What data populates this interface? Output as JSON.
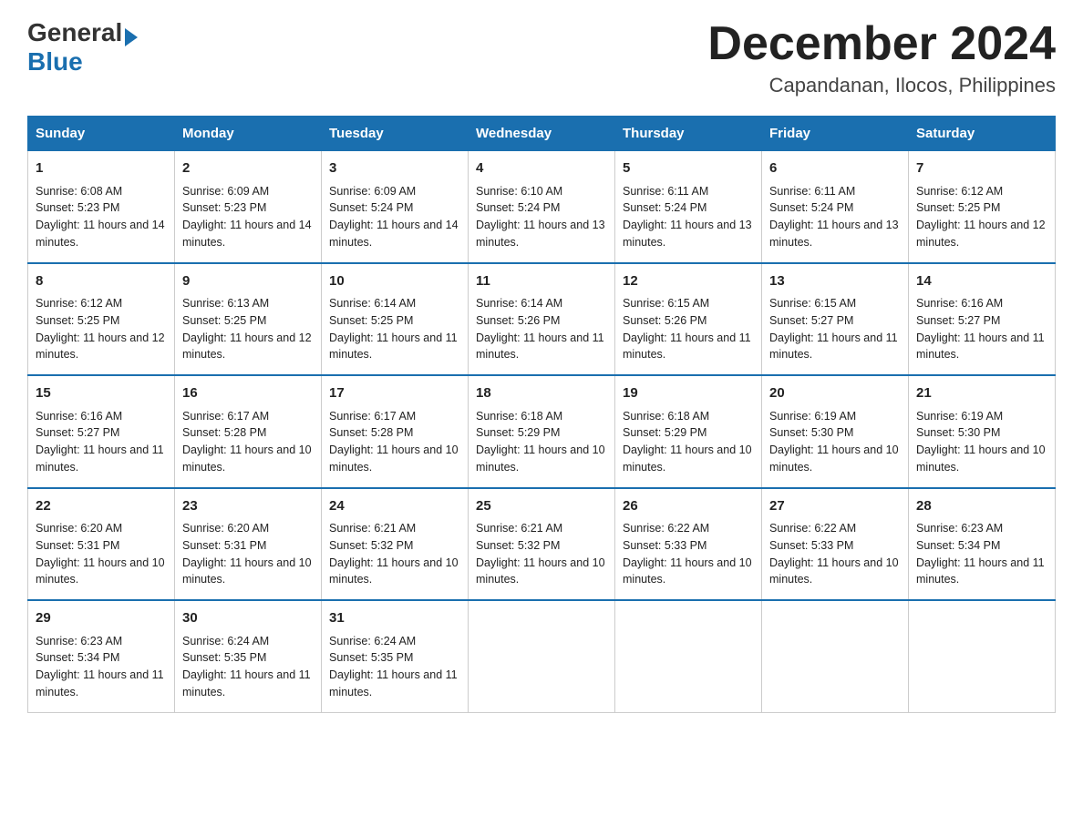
{
  "logo": {
    "general": "General",
    "blue": "Blue"
  },
  "header": {
    "month": "December 2024",
    "location": "Capandanan, Ilocos, Philippines"
  },
  "days": [
    "Sunday",
    "Monday",
    "Tuesday",
    "Wednesday",
    "Thursday",
    "Friday",
    "Saturday"
  ],
  "weeks": [
    [
      {
        "day": "1",
        "sunrise": "6:08 AM",
        "sunset": "5:23 PM",
        "daylight": "11 hours and 14 minutes."
      },
      {
        "day": "2",
        "sunrise": "6:09 AM",
        "sunset": "5:23 PM",
        "daylight": "11 hours and 14 minutes."
      },
      {
        "day": "3",
        "sunrise": "6:09 AM",
        "sunset": "5:24 PM",
        "daylight": "11 hours and 14 minutes."
      },
      {
        "day": "4",
        "sunrise": "6:10 AM",
        "sunset": "5:24 PM",
        "daylight": "11 hours and 13 minutes."
      },
      {
        "day": "5",
        "sunrise": "6:11 AM",
        "sunset": "5:24 PM",
        "daylight": "11 hours and 13 minutes."
      },
      {
        "day": "6",
        "sunrise": "6:11 AM",
        "sunset": "5:24 PM",
        "daylight": "11 hours and 13 minutes."
      },
      {
        "day": "7",
        "sunrise": "6:12 AM",
        "sunset": "5:25 PM",
        "daylight": "11 hours and 12 minutes."
      }
    ],
    [
      {
        "day": "8",
        "sunrise": "6:12 AM",
        "sunset": "5:25 PM",
        "daylight": "11 hours and 12 minutes."
      },
      {
        "day": "9",
        "sunrise": "6:13 AM",
        "sunset": "5:25 PM",
        "daylight": "11 hours and 12 minutes."
      },
      {
        "day": "10",
        "sunrise": "6:14 AM",
        "sunset": "5:25 PM",
        "daylight": "11 hours and 11 minutes."
      },
      {
        "day": "11",
        "sunrise": "6:14 AM",
        "sunset": "5:26 PM",
        "daylight": "11 hours and 11 minutes."
      },
      {
        "day": "12",
        "sunrise": "6:15 AM",
        "sunset": "5:26 PM",
        "daylight": "11 hours and 11 minutes."
      },
      {
        "day": "13",
        "sunrise": "6:15 AM",
        "sunset": "5:27 PM",
        "daylight": "11 hours and 11 minutes."
      },
      {
        "day": "14",
        "sunrise": "6:16 AM",
        "sunset": "5:27 PM",
        "daylight": "11 hours and 11 minutes."
      }
    ],
    [
      {
        "day": "15",
        "sunrise": "6:16 AM",
        "sunset": "5:27 PM",
        "daylight": "11 hours and 11 minutes."
      },
      {
        "day": "16",
        "sunrise": "6:17 AM",
        "sunset": "5:28 PM",
        "daylight": "11 hours and 10 minutes."
      },
      {
        "day": "17",
        "sunrise": "6:17 AM",
        "sunset": "5:28 PM",
        "daylight": "11 hours and 10 minutes."
      },
      {
        "day": "18",
        "sunrise": "6:18 AM",
        "sunset": "5:29 PM",
        "daylight": "11 hours and 10 minutes."
      },
      {
        "day": "19",
        "sunrise": "6:18 AM",
        "sunset": "5:29 PM",
        "daylight": "11 hours and 10 minutes."
      },
      {
        "day": "20",
        "sunrise": "6:19 AM",
        "sunset": "5:30 PM",
        "daylight": "11 hours and 10 minutes."
      },
      {
        "day": "21",
        "sunrise": "6:19 AM",
        "sunset": "5:30 PM",
        "daylight": "11 hours and 10 minutes."
      }
    ],
    [
      {
        "day": "22",
        "sunrise": "6:20 AM",
        "sunset": "5:31 PM",
        "daylight": "11 hours and 10 minutes."
      },
      {
        "day": "23",
        "sunrise": "6:20 AM",
        "sunset": "5:31 PM",
        "daylight": "11 hours and 10 minutes."
      },
      {
        "day": "24",
        "sunrise": "6:21 AM",
        "sunset": "5:32 PM",
        "daylight": "11 hours and 10 minutes."
      },
      {
        "day": "25",
        "sunrise": "6:21 AM",
        "sunset": "5:32 PM",
        "daylight": "11 hours and 10 minutes."
      },
      {
        "day": "26",
        "sunrise": "6:22 AM",
        "sunset": "5:33 PM",
        "daylight": "11 hours and 10 minutes."
      },
      {
        "day": "27",
        "sunrise": "6:22 AM",
        "sunset": "5:33 PM",
        "daylight": "11 hours and 10 minutes."
      },
      {
        "day": "28",
        "sunrise": "6:23 AM",
        "sunset": "5:34 PM",
        "daylight": "11 hours and 11 minutes."
      }
    ],
    [
      {
        "day": "29",
        "sunrise": "6:23 AM",
        "sunset": "5:34 PM",
        "daylight": "11 hours and 11 minutes."
      },
      {
        "day": "30",
        "sunrise": "6:24 AM",
        "sunset": "5:35 PM",
        "daylight": "11 hours and 11 minutes."
      },
      {
        "day": "31",
        "sunrise": "6:24 AM",
        "sunset": "5:35 PM",
        "daylight": "11 hours and 11 minutes."
      },
      null,
      null,
      null,
      null
    ]
  ],
  "labels": {
    "sunrise": "Sunrise: ",
    "sunset": "Sunset: ",
    "daylight": "Daylight: "
  }
}
